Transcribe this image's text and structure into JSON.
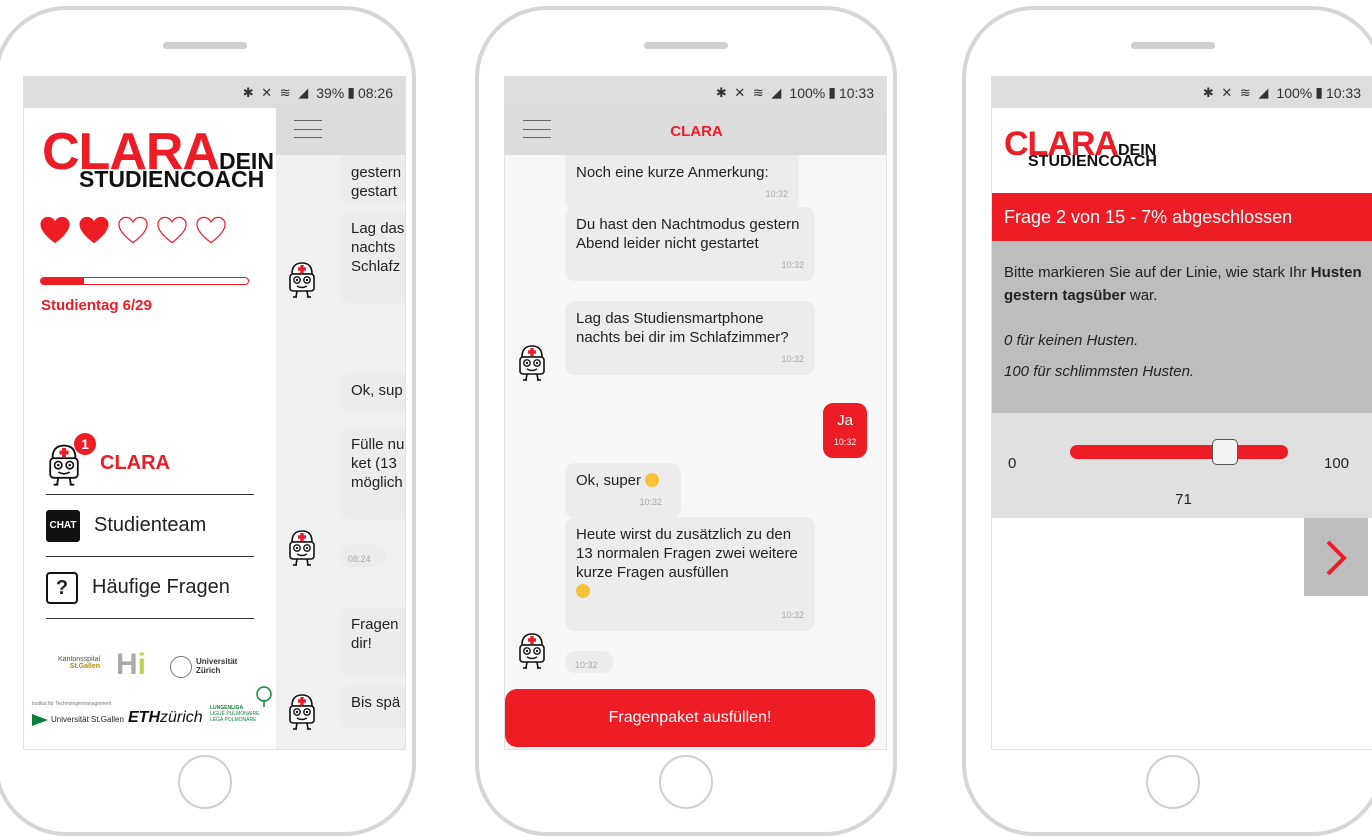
{
  "colors": {
    "accent": "#ee1c25",
    "bubble": "#ececec"
  },
  "screen1": {
    "status": {
      "icons": "bluetooth mute wifi signal",
      "battery": "39%",
      "time": "08:26"
    },
    "logo": {
      "big": "CLARA",
      "small_top": "DEIN",
      "small_bottom": "STUDIENCOACH"
    },
    "hearts": {
      "filled": 2,
      "total": 5
    },
    "progress": {
      "value": 0.21
    },
    "study_day": "Studientag 6/29",
    "menu": [
      {
        "label": "CLARA",
        "badge": "1",
        "icon": "robot-icon"
      },
      {
        "label": "Studienteam",
        "icon": "chat-icon"
      },
      {
        "label": "Häufige Fragen",
        "icon": "question-icon"
      }
    ],
    "partners": {
      "ksg_line1": "Kantonsspital",
      "ksg_line2": "St.Gallen",
      "uzh_line1": "Universität",
      "uzh_line2": "Zürich",
      "hsg_small": "Institut für Technologiemanagement",
      "hsg": "Universität St.Gallen",
      "eth_bold": "ETH",
      "eth_rest": "zürich",
      "lunge1": "LUNGENLIGA",
      "lunge2": "LIGUE PULMONAIRE",
      "lunge3": "LEGA POLMONARE"
    },
    "chat_fragments": [
      {
        "text": "gestern\ngestart"
      },
      {
        "text": "Lag das\nnachts\nSchlafz"
      },
      {
        "text": "Ok, sup"
      },
      {
        "text": "Fülle nu\nket (13\nmöglich"
      },
      {
        "text": "08:24"
      },
      {
        "text": "Fragen\ndir!"
      },
      {
        "text": "Bis spä"
      }
    ]
  },
  "screen2": {
    "status": {
      "battery": "100%",
      "time": "10:33"
    },
    "title": "CLARA",
    "messages": [
      {
        "text": "Noch eine kurze Anmerkung:",
        "time": "10:32"
      },
      {
        "text": "Du hast den Nachtmodus gestern Abend leider nicht gestartet",
        "time": "10:32"
      },
      {
        "text": "Lag das Studiensmartphone nachts bei dir im Schlafzimmer?",
        "time": "10:32"
      },
      {
        "text": "Ja",
        "time": "10:32"
      },
      {
        "text": "Ok, super",
        "time": "10:32"
      },
      {
        "text": "Heute wirst du zusätzlich zu den 13 normalen Fragen zwei weitere kurze Fragen ausfüllen",
        "time": "10:32"
      },
      {
        "text": "10:32"
      }
    ],
    "button": "Fragenpaket ausfüllen!"
  },
  "screen3": {
    "status": {
      "battery": "100%",
      "time": "10:33"
    },
    "logo": {
      "big": "CLARA",
      "small_top": "DEIN",
      "small_bottom": "STUDIENCOACH"
    },
    "question_header": "Frage 2 von 15 - 7% abgeschlossen",
    "question": {
      "text_before": "Bitte markieren Sie auf der Linie, wie stark Ihr ",
      "text_bold": "Husten gestern tagsüber",
      "text_after": " war.",
      "hint_min": "0 für keinen Husten.",
      "hint_max": "100 für schlimmsten Husten."
    },
    "slider": {
      "min": "0",
      "max": "100",
      "value": 71,
      "value_label": "71"
    },
    "next_icon": "chevron-right-icon"
  }
}
